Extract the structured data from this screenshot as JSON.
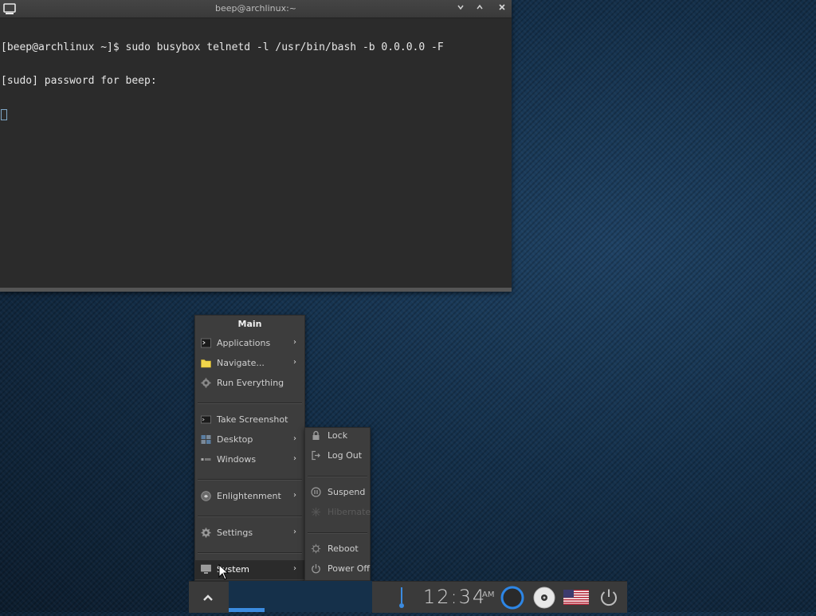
{
  "terminal": {
    "title": "beep@archlinux:~",
    "lines": [
      "[beep@archlinux ~]$ sudo busybox telnetd -l /usr/bin/bash -b 0.0.0.0 -F",
      "[sudo] password for beep:"
    ]
  },
  "main_menu": {
    "title": "Main",
    "items": [
      {
        "label": "Applications",
        "icon": "terminal-icon"
      },
      {
        "label": "Navigate...",
        "icon": "folder-icon"
      },
      {
        "label": "Run Everything",
        "icon": "gear-icon"
      },
      {
        "label": "Take Screenshot",
        "icon": "screenshot-icon"
      },
      {
        "label": "Desktop",
        "icon": "desktop-icon"
      },
      {
        "label": "Windows",
        "icon": "windows-icon"
      },
      {
        "label": "Enlightenment",
        "icon": "enlightenment-icon"
      },
      {
        "label": "Settings",
        "icon": "gear-icon"
      },
      {
        "label": "System",
        "icon": "monitor-icon"
      }
    ]
  },
  "system_menu": {
    "items": [
      {
        "label": "Lock",
        "icon": "lock-icon"
      },
      {
        "label": "Log Out",
        "icon": "logout-icon"
      },
      {
        "label": "Suspend",
        "icon": "suspend-icon"
      },
      {
        "label": "Hibernate",
        "icon": "hibernate-icon"
      },
      {
        "label": "Reboot",
        "icon": "reboot-icon"
      },
      {
        "label": "Power Off",
        "icon": "power-icon"
      }
    ]
  },
  "shelf": {
    "clock": "12:34",
    "ampm": "AM"
  },
  "colors": {
    "accent": "#3b8be0",
    "menu_bg": "#3d3d3d",
    "terminal_bg": "#2b2b2b"
  }
}
